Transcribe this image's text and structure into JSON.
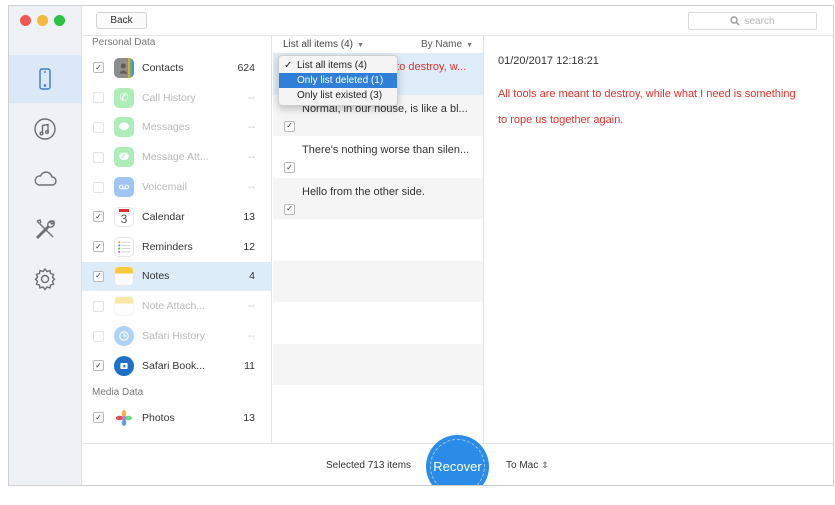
{
  "window": {
    "controls": [
      "close",
      "minimize",
      "zoom"
    ]
  },
  "rail": {
    "items": [
      {
        "icon": "phone-icon",
        "active": true
      },
      {
        "icon": "music-icon",
        "active": false
      },
      {
        "icon": "cloud-icon",
        "active": false
      },
      {
        "icon": "tools-icon",
        "active": false
      },
      {
        "icon": "gear-icon",
        "active": false
      }
    ]
  },
  "toolbar": {
    "back_label": "Back",
    "search_placeholder": "search"
  },
  "categories": {
    "personal_label": "Personal Data",
    "media_label": "Media Data",
    "personal": [
      {
        "label": "Contacts",
        "count": "624",
        "checked": true,
        "enabled": true,
        "icon": "contacts-icon"
      },
      {
        "label": "Call History",
        "count": "--",
        "checked": false,
        "enabled": false,
        "icon": "phone-call-icon"
      },
      {
        "label": "Messages",
        "count": "--",
        "checked": false,
        "enabled": false,
        "icon": "messages-icon"
      },
      {
        "label": "Message Att...",
        "count": "--",
        "checked": false,
        "enabled": false,
        "icon": "message-attachment-icon"
      },
      {
        "label": "Voicemail",
        "count": "--",
        "checked": false,
        "enabled": false,
        "icon": "voicemail-icon"
      },
      {
        "label": "Calendar",
        "count": "13",
        "checked": true,
        "enabled": true,
        "icon": "calendar-icon"
      },
      {
        "label": "Reminders",
        "count": "12",
        "checked": true,
        "enabled": true,
        "icon": "reminders-icon"
      },
      {
        "label": "Notes",
        "count": "4",
        "checked": true,
        "enabled": true,
        "active": true,
        "icon": "notes-icon"
      },
      {
        "label": "Note Attach...",
        "count": "--",
        "checked": false,
        "enabled": false,
        "icon": "note-attachment-icon"
      },
      {
        "label": "Safari History",
        "count": "--",
        "checked": false,
        "enabled": false,
        "icon": "safari-history-icon"
      },
      {
        "label": "Safari Book...",
        "count": "11",
        "checked": true,
        "enabled": true,
        "icon": "safari-bookmark-icon"
      }
    ],
    "media": [
      {
        "label": "Photos",
        "count": "13",
        "checked": true,
        "enabled": true,
        "icon": "photos-icon"
      }
    ],
    "calendar_day": "3"
  },
  "list": {
    "filter_label": "List all items (4)",
    "sort_label": "By Name",
    "filter_options": [
      {
        "label": "List all items (4)",
        "checked": true,
        "highlighted": false
      },
      {
        "label": "Only list deleted (1)",
        "checked": false,
        "highlighted": true
      },
      {
        "label": "Only list existed (3)",
        "checked": false,
        "highlighted": false
      }
    ],
    "items": [
      {
        "text": "All tools are meant to destroy, w...",
        "deleted": true,
        "checked": true,
        "selected": true
      },
      {
        "text": "Normal, in our house, is like a bl...",
        "deleted": false,
        "checked": true,
        "selected": false
      },
      {
        "text": "There's nothing worse than silen...",
        "deleted": false,
        "checked": true,
        "selected": false
      },
      {
        "text": "Hello from the other side.",
        "deleted": false,
        "checked": true,
        "selected": false
      }
    ]
  },
  "detail": {
    "timestamp": "01/20/2017 12:18:21",
    "body": "All tools are meant to destroy, while what I need is something to rope us together again."
  },
  "footer": {
    "selected_text": "Selected 713 items",
    "recover_label": "Recover",
    "destination_label": "To Mac"
  },
  "colors": {
    "accent": "#2a8ce6",
    "deleted_text": "#e0322c",
    "selection": "#ddecf9",
    "menu_highlight": "#2f7fd8"
  }
}
